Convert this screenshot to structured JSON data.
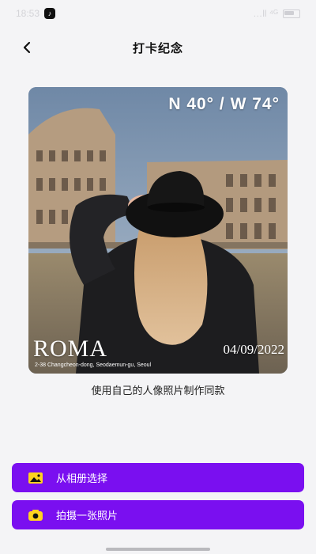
{
  "status_bar": {
    "time": "18:53",
    "signal_text": "…ll ⁴ᴳ"
  },
  "nav": {
    "title": "打卡纪念"
  },
  "photo": {
    "coordinates": "N 40° / W 74°",
    "city": "ROMA",
    "address": "2-38 Changcheon-dong, Seodaemun-gu, Seoul",
    "date": "04/09/2022"
  },
  "caption": "使用自己的人像照片制作同款",
  "buttons": {
    "album": "从相册选择",
    "camera": "拍摄一张照片"
  },
  "colors": {
    "accent": "#7a0ff0",
    "icon_yellow": "#ffd21f"
  }
}
